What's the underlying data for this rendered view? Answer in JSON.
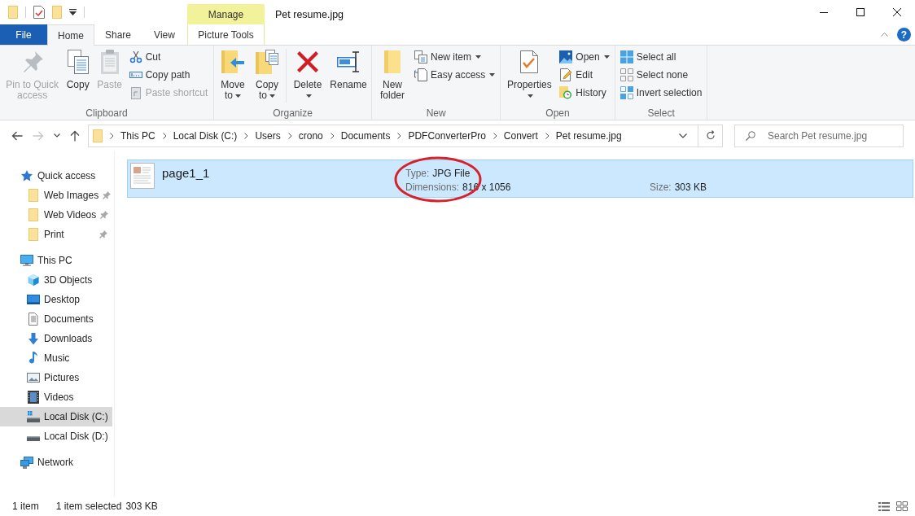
{
  "window": {
    "title": "Pet resume.jpg"
  },
  "contextual_tab_group": {
    "label": "Manage"
  },
  "tabs": [
    {
      "label": "File",
      "kind": "file",
      "selected": false
    },
    {
      "label": "Home",
      "kind": "standard",
      "selected": true
    },
    {
      "label": "Share",
      "kind": "standard",
      "selected": false
    },
    {
      "label": "View",
      "kind": "standard",
      "selected": false
    },
    {
      "label": "Picture Tools",
      "kind": "contextual",
      "selected": false
    }
  ],
  "help_button": {
    "label": "?"
  },
  "ribbon": {
    "groups": [
      {
        "label": "Clipboard",
        "commands": [
          {
            "label": "Pin to Quick access",
            "kind": "large",
            "disabled": true,
            "dropdown": false
          },
          {
            "label": "Copy",
            "kind": "large",
            "disabled": false,
            "dropdown": false
          },
          {
            "label": "Paste",
            "kind": "large",
            "disabled": true,
            "dropdown": false
          },
          {
            "label": "Cut",
            "kind": "small",
            "disabled": false,
            "dropdown": false
          },
          {
            "label": "Copy path",
            "kind": "small",
            "disabled": false,
            "dropdown": false
          },
          {
            "label": "Paste shortcut",
            "kind": "small",
            "disabled": true,
            "dropdown": false
          }
        ]
      },
      {
        "label": "Organize",
        "commands": [
          {
            "label": "Move to",
            "kind": "large",
            "disabled": false,
            "dropdown": true
          },
          {
            "label": "Copy to",
            "kind": "large",
            "disabled": false,
            "dropdown": true
          },
          {
            "label": "Delete",
            "kind": "large",
            "disabled": false,
            "dropdown": true
          },
          {
            "label": "Rename",
            "kind": "large",
            "disabled": false,
            "dropdown": false
          }
        ]
      },
      {
        "label": "New",
        "commands": [
          {
            "label": "New folder",
            "kind": "large",
            "disabled": false,
            "dropdown": false
          },
          {
            "label": "New item",
            "kind": "small",
            "disabled": false,
            "dropdown": true
          },
          {
            "label": "Easy access",
            "kind": "small",
            "disabled": false,
            "dropdown": true
          }
        ]
      },
      {
        "label": "Open",
        "commands": [
          {
            "label": "Properties",
            "kind": "large",
            "disabled": false,
            "dropdown": true
          },
          {
            "label": "Open",
            "kind": "small",
            "disabled": false,
            "dropdown": true
          },
          {
            "label": "Edit",
            "kind": "small",
            "disabled": false,
            "dropdown": false
          },
          {
            "label": "History",
            "kind": "small",
            "disabled": false,
            "dropdown": false
          }
        ]
      },
      {
        "label": "Select",
        "commands": [
          {
            "label": "Select all",
            "kind": "small",
            "disabled": false,
            "dropdown": false
          },
          {
            "label": "Select none",
            "kind": "small",
            "disabled": false,
            "dropdown": false
          },
          {
            "label": "Invert selection",
            "kind": "small",
            "disabled": false,
            "dropdown": false
          }
        ]
      }
    ]
  },
  "address_bar": {
    "nav_buttons": [
      {
        "kind": "back",
        "disabled": false
      },
      {
        "kind": "forward",
        "disabled": true
      },
      {
        "kind": "recent",
        "disabled": false
      },
      {
        "kind": "up",
        "disabled": false
      }
    ],
    "path": [
      "This PC",
      "Local Disk (C:)",
      "Users",
      "crono",
      "Documents",
      "PDFConverterPro",
      "Convert",
      "Pet resume.jpg"
    ]
  },
  "search": {
    "placeholder": "Search Pet resume.jpg"
  },
  "navigation_pane": {
    "items": [
      {
        "label": "Quick access",
        "selected": false,
        "children": [
          {
            "label": "Web Images",
            "selected": false,
            "pinned": true
          },
          {
            "label": "Web Videos",
            "selected": false,
            "pinned": true
          },
          {
            "label": "Print",
            "selected": false,
            "pinned": true
          }
        ]
      },
      {
        "label": "This PC",
        "selected": false,
        "children": [
          {
            "label": "3D Objects",
            "selected": false
          },
          {
            "label": "Desktop",
            "selected": false
          },
          {
            "label": "Documents",
            "selected": false
          },
          {
            "label": "Downloads",
            "selected": false
          },
          {
            "label": "Music",
            "selected": false
          },
          {
            "label": "Pictures",
            "selected": false
          },
          {
            "label": "Videos",
            "selected": false
          },
          {
            "label": "Local Disk (C:)",
            "selected": true
          },
          {
            "label": "Local Disk (D:)",
            "selected": false
          }
        ]
      },
      {
        "label": "Network",
        "selected": false
      }
    ]
  },
  "files": [
    {
      "name": "page1_1",
      "selected": true,
      "details": [
        {
          "label": "Type:",
          "value": "JPG File"
        },
        {
          "label": "Dimensions:",
          "value": "816 x 1056"
        }
      ],
      "size": {
        "label": "Size:",
        "value": "303 KB"
      }
    }
  ],
  "status_bar": {
    "item_count": "1 item",
    "selection": "1 item selected",
    "selection_size": "303 KB"
  }
}
